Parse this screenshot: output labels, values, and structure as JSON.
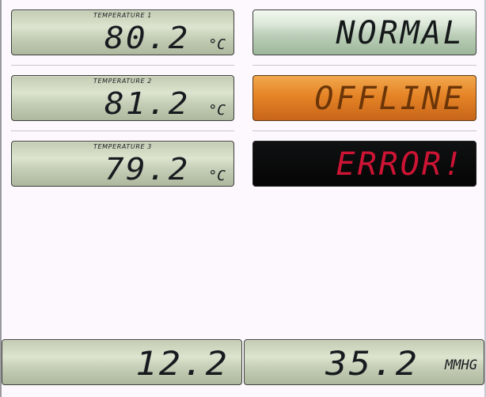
{
  "temperatures": [
    {
      "label": "TEMPERATURE 1",
      "value": "80.2",
      "unit": "°C"
    },
    {
      "label": "TEMPERATURE 2",
      "value": "81.2",
      "unit": "°C"
    },
    {
      "label": "TEMPERATURE 3",
      "value": "79.2",
      "unit": "°C"
    }
  ],
  "statuses": [
    {
      "text": "NORMAL",
      "state": "normal"
    },
    {
      "text": "OFFLINE",
      "state": "offline"
    },
    {
      "text": "ERROR!",
      "state": "error"
    }
  ],
  "bottom": [
    {
      "value": "12.2",
      "unit": ""
    },
    {
      "value": "35.2",
      "unit": "MMHG"
    }
  ],
  "colors": {
    "lcd_background": "#d4dcc4",
    "normal_text": "#15191a",
    "offline_background": "#e3801f",
    "offline_text": "#6b3508",
    "error_background": "#0a0a0a",
    "error_text": "#ce1434"
  }
}
